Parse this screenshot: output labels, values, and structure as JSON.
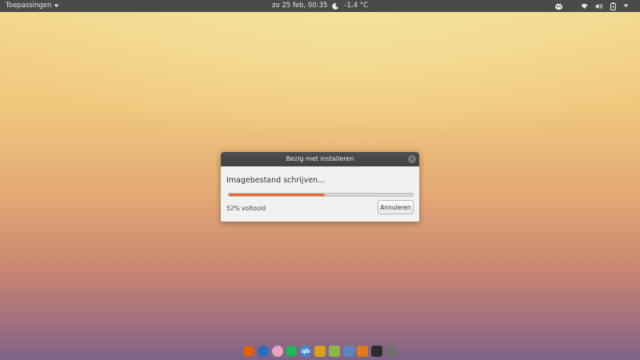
{
  "topbar": {
    "apps_label": "Toepassingen",
    "datetime": "zo 25 feb, 00:35",
    "weather": "-1,4 °C",
    "icons": [
      "chevron-down-icon",
      "weather-night-icon",
      "bug-icon",
      "wifi-icon",
      "volume-icon",
      "battery-icon",
      "power-chevron-icon"
    ]
  },
  "dialog": {
    "title": "Bezig met installeren",
    "heading": "Imagebestand schrijven...",
    "progress": 0.52,
    "status": "52% voltooid",
    "cancel_label": "Annuleren"
  },
  "dock": {
    "items": [
      {
        "name": "firefox",
        "color": "#e66000",
        "glyph": ""
      },
      {
        "name": "thunderbird",
        "color": "#2a6dbf",
        "glyph": ""
      },
      {
        "name": "candy",
        "color": "#e8a3c0",
        "glyph": ""
      },
      {
        "name": "spotify",
        "color": "#1db954",
        "glyph": ""
      },
      {
        "name": "qbittorrent",
        "color": "#3f8bd6",
        "glyph": "qb"
      },
      {
        "name": "puzzle",
        "color": "#d8a21c",
        "glyph": ""
      },
      {
        "name": "rss",
        "color": "#8fb640",
        "glyph": ""
      },
      {
        "name": "calculator",
        "color": "#5a86c0",
        "glyph": ""
      },
      {
        "name": "settings",
        "color": "#e07a1b",
        "glyph": ""
      },
      {
        "name": "terminal",
        "color": "#2d2d2d",
        "glyph": ""
      },
      {
        "name": "installer",
        "color": "#6f6f6f",
        "glyph": ""
      }
    ]
  }
}
